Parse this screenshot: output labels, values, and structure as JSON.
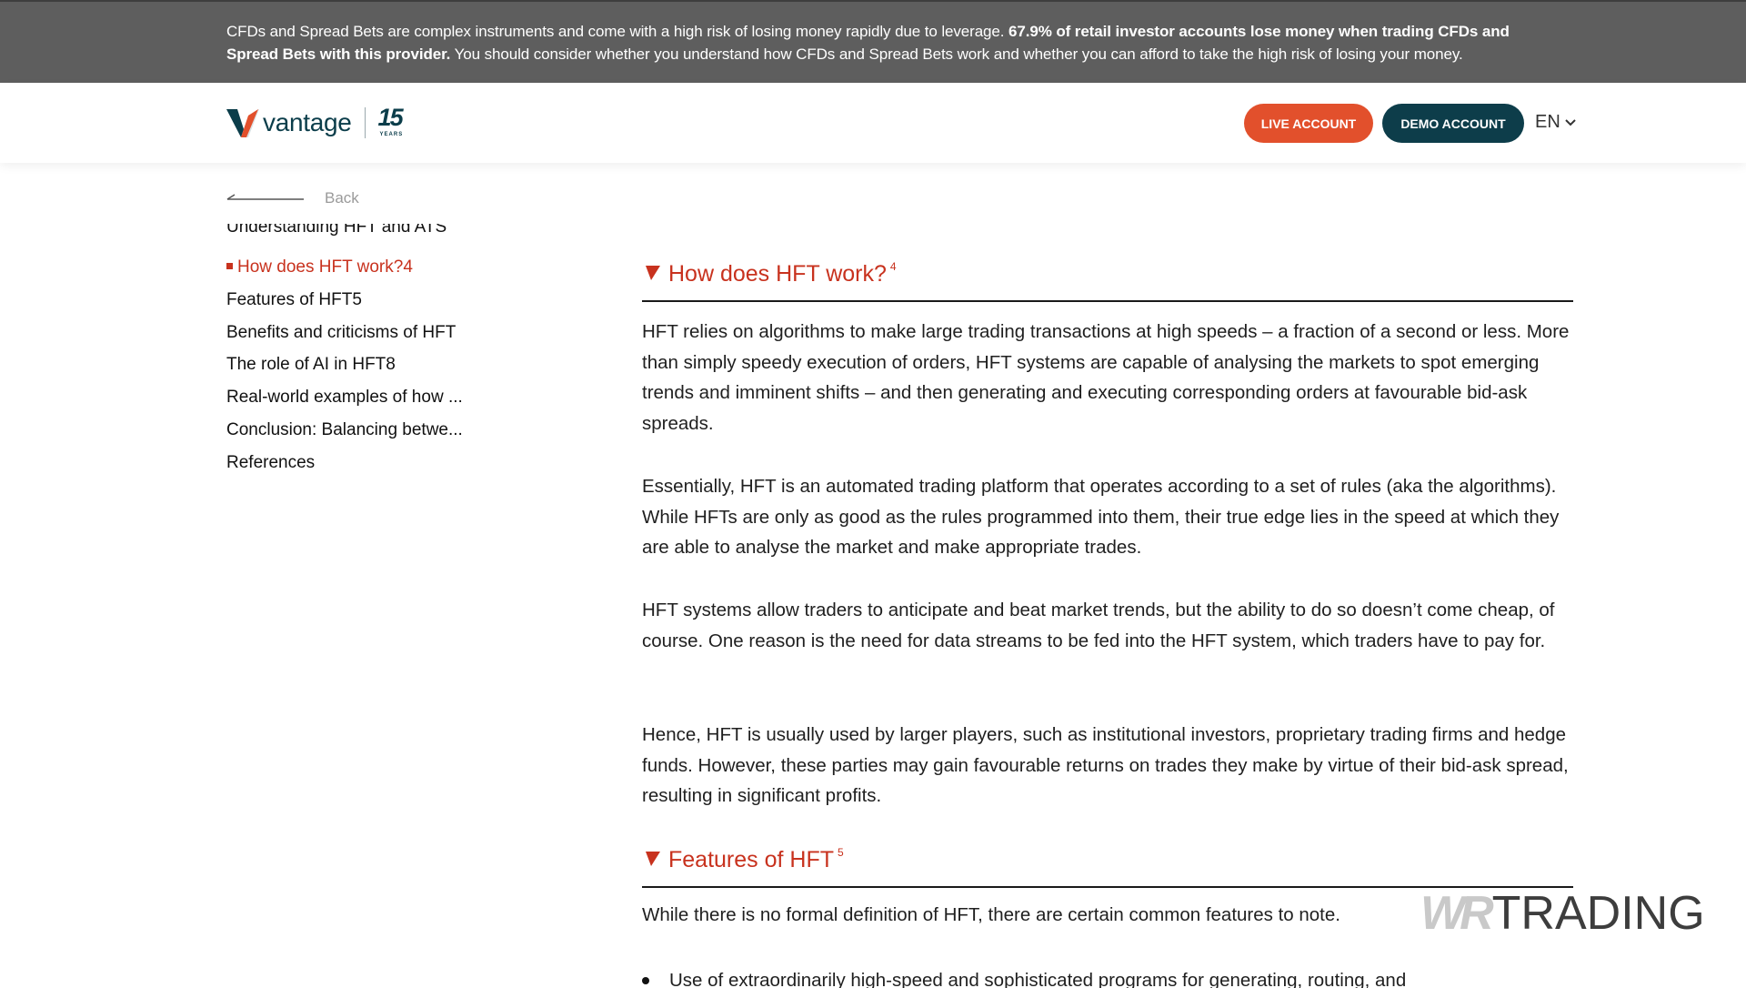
{
  "risk_banner": {
    "text_before": "CFDs and Spread Bets are complex instruments and come with a high risk of losing money rapidly due to leverage. ",
    "text_bold": "67.9% of retail investor accounts lose money when trading CFDs and Spread Bets with this provider.",
    "text_after": " You should consider whether you understand how CFDs and Spread Bets work and whether you can afford to take the high risk of losing your money."
  },
  "header": {
    "logo_text": "vantage",
    "logo_years": "15",
    "logo_years_label": "YEARS",
    "live_account": "LIVE ACCOUNT",
    "demo_account": "DEMO ACCOUNT",
    "language": "EN"
  },
  "back": {
    "label": "Back"
  },
  "toc": {
    "items": [
      {
        "label": "Understanding HFT and ATS",
        "active": false
      },
      {
        "label": "How does HFT work?4",
        "active": true
      },
      {
        "label": "Features of HFT5",
        "active": false
      },
      {
        "label": "Benefits and criticisms of HFT",
        "active": false
      },
      {
        "label": "The role of AI in HFT8",
        "active": false
      },
      {
        "label": "Real-world examples of how ...",
        "active": false
      },
      {
        "label": "Conclusion: Balancing betwe...",
        "active": false
      },
      {
        "label": "References",
        "active": false
      }
    ]
  },
  "article": {
    "section1": {
      "title": "How does HFT work?",
      "sup": "4",
      "paragraphs": [
        "HFT relies on algorithms to make large trading transactions at high speeds – a fraction of a second or less. More than simply speedy execution of orders, HFT systems are capable of analysing the markets to spot emerging trends and imminent shifts – and then generating and executing corresponding orders at favourable bid-ask spreads.",
        "Essentially, HFT is an automated trading platform that operates according to a set of rules (aka the algorithms). While HFTs are only as good as the rules programmed into them, their true edge lies in the speed at which they are able to analyse the market and make appropriate trades.",
        "HFT systems allow traders to anticipate and beat market trends, but the ability to do so doesn’t come cheap, of course. One reason is the need for data streams to be fed into the HFT system, which traders have to pay for.",
        "Hence, HFT is usually used by larger players, such as institutional investors, proprietary trading firms and hedge funds. However, these parties may gain favourable returns on trades they make by virtue of their bid-ask spread, resulting in significant profits."
      ]
    },
    "section2": {
      "title": "Features of HFT",
      "sup": "5",
      "intro": "While there is no formal definition of HFT, there are certain common features to note.",
      "bullet1": "Use of extraordinarily high-speed and sophisticated programs for generating, routing, and"
    }
  },
  "watermark": {
    "left": "WR",
    "right": "TRADING"
  },
  "colors": {
    "banner_bg": "#5e5e5e",
    "brand_dark": "#0d3d4a",
    "live_orange": "#e2502c",
    "accent_red": "#c8321e"
  }
}
